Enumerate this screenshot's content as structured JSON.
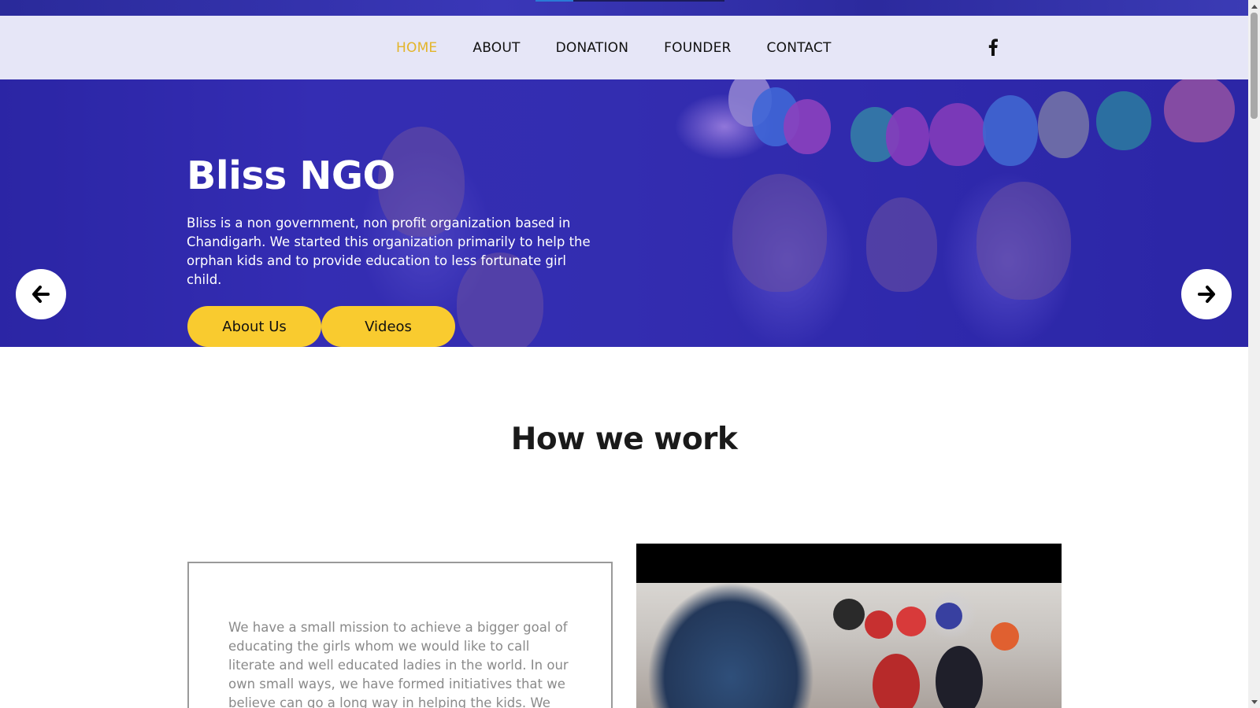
{
  "nav": {
    "items": [
      {
        "label": "HOME",
        "active": true
      },
      {
        "label": "ABOUT",
        "active": false
      },
      {
        "label": "DONATION",
        "active": false
      },
      {
        "label": "FOUNDER",
        "active": false
      },
      {
        "label": "CONTACT",
        "active": false
      }
    ],
    "social_icon": "facebook-icon",
    "active_color": "#e3b52a"
  },
  "hero": {
    "title": "Bliss NGO",
    "description": "Bliss is a non government, non profit organization based in Chandigarh. We started this organization primarily to help the orphan kids and to provide education to less fortunate girl child.",
    "buttons": {
      "about": "About Us",
      "videos": "Videos"
    },
    "prev_icon": "arrow-left-icon",
    "next_icon": "arrow-right-icon",
    "button_color": "#f9cb2f"
  },
  "how_we_work": {
    "title": "How we work",
    "text": "We have a small mission to achieve a bigger goal of educating the girls whom we would like to call literate and well educated ladies in the world. In our own small ways, we have formed initiatives that we believe can go a long way in helping the kids. We often visit"
  }
}
